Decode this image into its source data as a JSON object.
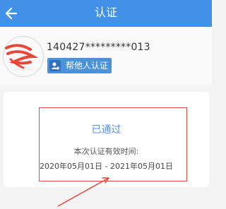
{
  "header": {
    "title": "认证",
    "back_icon": "back-arrow-icon"
  },
  "profile": {
    "id_number": "140427*********013",
    "help_button_label": "帮他人认证",
    "help_icon": "user-plus-icon"
  },
  "verification": {
    "status": "已通过",
    "validity_label": "本次认证有效时间:",
    "validity_range": "2020年05月01日 - 2021年05月01日"
  },
  "colors": {
    "header_bg": "#4191e8",
    "accent_blue": "#4b92dc",
    "annotation_red": "#e8453b"
  }
}
